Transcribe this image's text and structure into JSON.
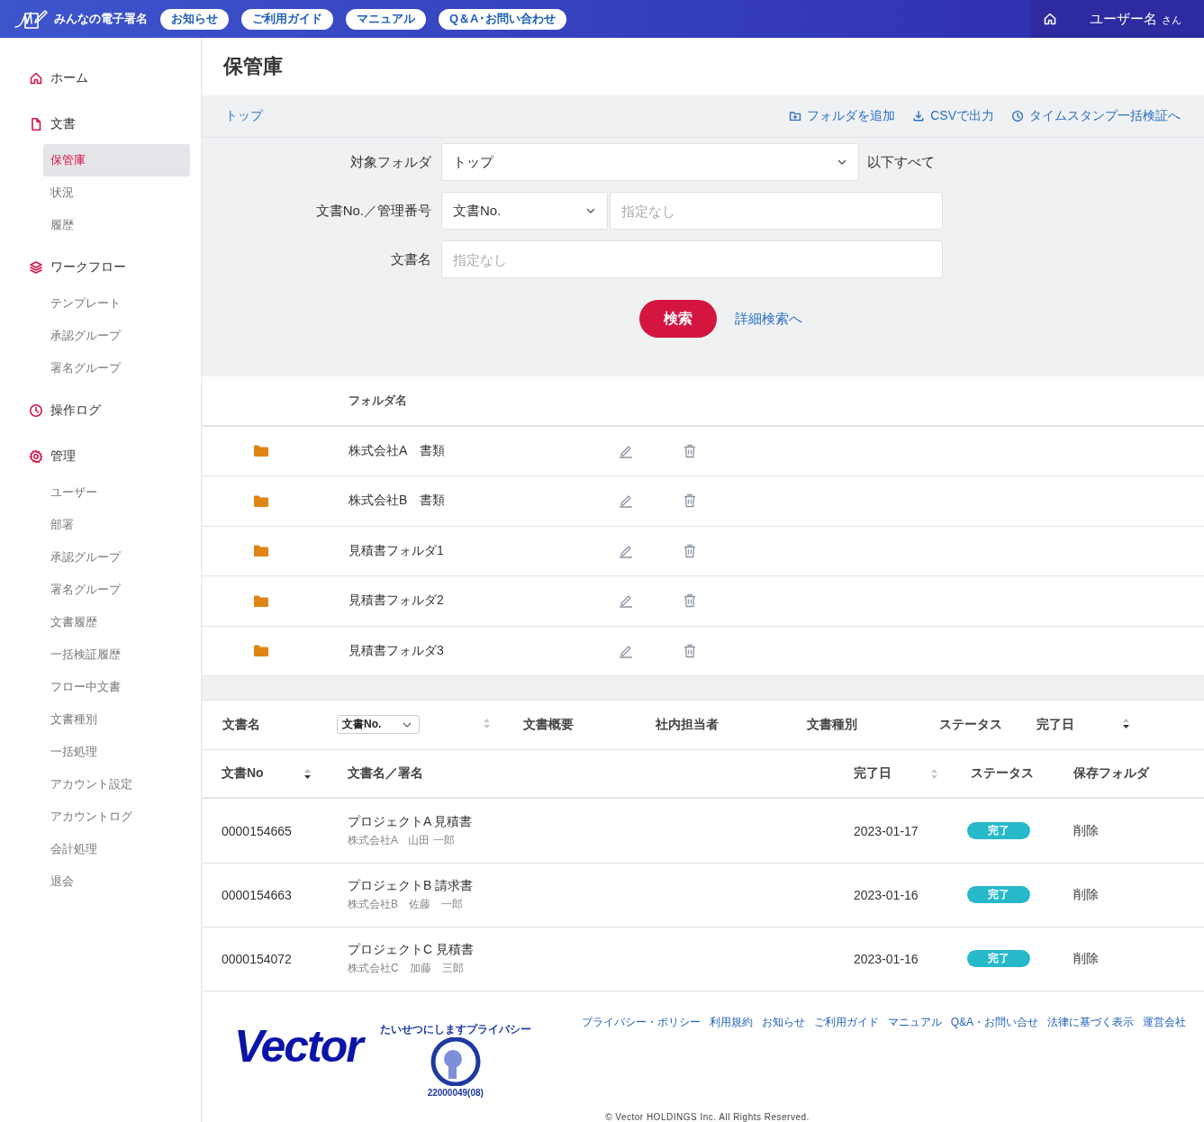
{
  "header": {
    "brand": "みんなの電子署名",
    "nav_links": [
      "お知らせ",
      "ご利用ガイド",
      "マニュアル",
      "Q＆A･お問い合わせ"
    ],
    "user_name": "ユーザー名",
    "user_suffix": "さん"
  },
  "sidebar": {
    "sections": [
      {
        "label": "ホーム"
      },
      {
        "label": "文書",
        "children": [
          {
            "label": "保管庫",
            "selected": true
          },
          {
            "label": "状況",
            "selected": false
          },
          {
            "label": "履歴",
            "selected": false
          }
        ]
      },
      {
        "label": "ワークフロー",
        "children": [
          {
            "label": "テンプレート",
            "selected": false
          },
          {
            "label": "承認グループ",
            "selected": false
          },
          {
            "label": "署名グループ",
            "selected": false
          }
        ]
      },
      {
        "label": "操作ログ"
      },
      {
        "label": "管理",
        "children": [
          {
            "label": "ユーザー",
            "selected": false
          },
          {
            "label": "部署",
            "selected": false
          },
          {
            "label": "承認グループ",
            "selected": false
          },
          {
            "label": "署名グループ",
            "selected": false
          },
          {
            "label": "文書履歴",
            "selected": false
          },
          {
            "label": "一括検証履歴",
            "selected": false
          },
          {
            "label": "フロー中文書",
            "selected": false
          },
          {
            "label": "文書種別",
            "selected": false
          },
          {
            "label": "一括処理",
            "selected": false
          },
          {
            "label": "アカウント設定",
            "selected": false
          },
          {
            "label": "アカウントログ",
            "selected": false
          },
          {
            "label": "会計処理",
            "selected": false
          },
          {
            "label": "退会",
            "selected": false
          }
        ]
      }
    ]
  },
  "page_title": "保管庫",
  "breadcrumb": "トップ",
  "actions": [
    "フォルダを追加",
    "CSVで出力",
    "タイムスタンプ一括検証へ"
  ],
  "search": {
    "folder_label": "対象フォルダ",
    "folder_value": "トップ",
    "folder_suffix": "以下すべて",
    "number_label": "文書No.／管理番号",
    "number_select": "文書No.",
    "number_placeholder": "指定なし",
    "name_label": "文書名",
    "name_placeholder": "指定なし",
    "search_button": "検索",
    "advanced_link": "詳細検索へ"
  },
  "folders": {
    "column": "フォルダ名",
    "rows": [
      "株式会社A　書類",
      "株式会社B　書類",
      "見積書フォルダ1",
      "見積書フォルダ2",
      "見積書フォルダ3"
    ]
  },
  "sort_bar": [
    {
      "kind": "label",
      "label": "文書名"
    },
    {
      "kind": "select",
      "label": "文書No."
    },
    {
      "kind": "sort",
      "active": false
    },
    {
      "kind": "label",
      "label": "文書概要"
    },
    {
      "kind": "label",
      "label": "社内担当者"
    },
    {
      "kind": "label",
      "label": "文書種別"
    },
    {
      "kind": "label",
      "label": "ステータス"
    },
    {
      "kind": "label",
      "label": "完了日"
    },
    {
      "kind": "sort",
      "active": true
    }
  ],
  "documents": {
    "columns": [
      {
        "label": "文書No",
        "sort_active": true
      },
      {
        "label": "文書名／署名"
      },
      {
        "label": "完了日",
        "sort_active": false
      },
      {
        "label": "ステータス"
      },
      {
        "label": "保存フォルダ"
      }
    ],
    "rows": [
      {
        "number": "0000154665",
        "title": "プロジェクトA 見積書",
        "signer": "株式会社A　山田 一郎",
        "date": "2023-01-17",
        "status": "完了",
        "folder": "削除"
      },
      {
        "number": "0000154663",
        "title": "プロジェクトB 請求書",
        "signer": "株式会社B　佐藤　一郎",
        "date": "2023-01-16",
        "status": "完了",
        "folder": "削除"
      },
      {
        "number": "0000154072",
        "title": "プロジェクトC 見積書",
        "signer": "株式会社C　加藤　三郎",
        "date": "2023-01-16",
        "status": "完了",
        "folder": "削除"
      }
    ]
  },
  "footer": {
    "logo": "Vector",
    "privacy_caption": "たいせつにしますプライバシー",
    "privacy_number": "22000049(08)",
    "links": [
      "プライバシー・ポリシー",
      "利用規約",
      "お知らせ",
      "ご利用ガイド",
      "マニュアル",
      "Q&A・お問い合せ",
      "法律に基づく表示",
      "運営会社"
    ],
    "copyright": "© Vector HOLDINGS Inc. All Rights Reserved."
  }
}
